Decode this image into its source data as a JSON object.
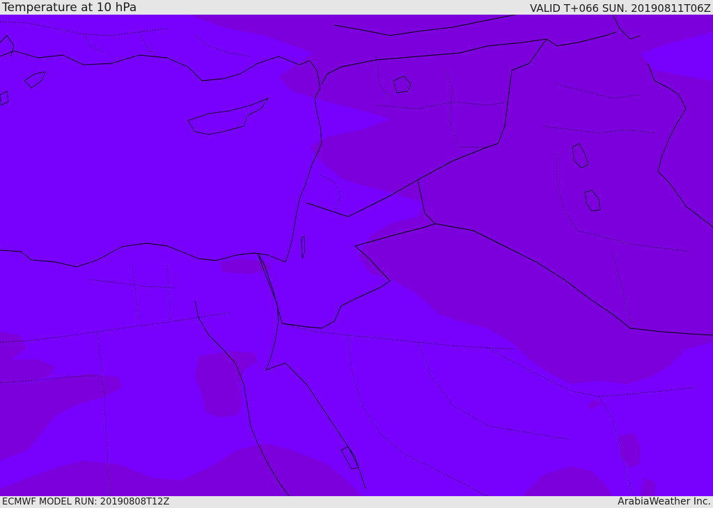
{
  "header": {
    "title": "Temperature at 10 hPa",
    "valid": "VALID T+066 SUN. 20190811T06Z"
  },
  "footer": {
    "model_run": "ECMWF MODEL RUN: 20190808T12Z",
    "credit": "ArabiaWeather Inc."
  },
  "colors": {
    "field_light": "#7800fd",
    "field_dark": "#7b00dc",
    "border": "#000000",
    "bar": "#e6e6e6"
  }
}
